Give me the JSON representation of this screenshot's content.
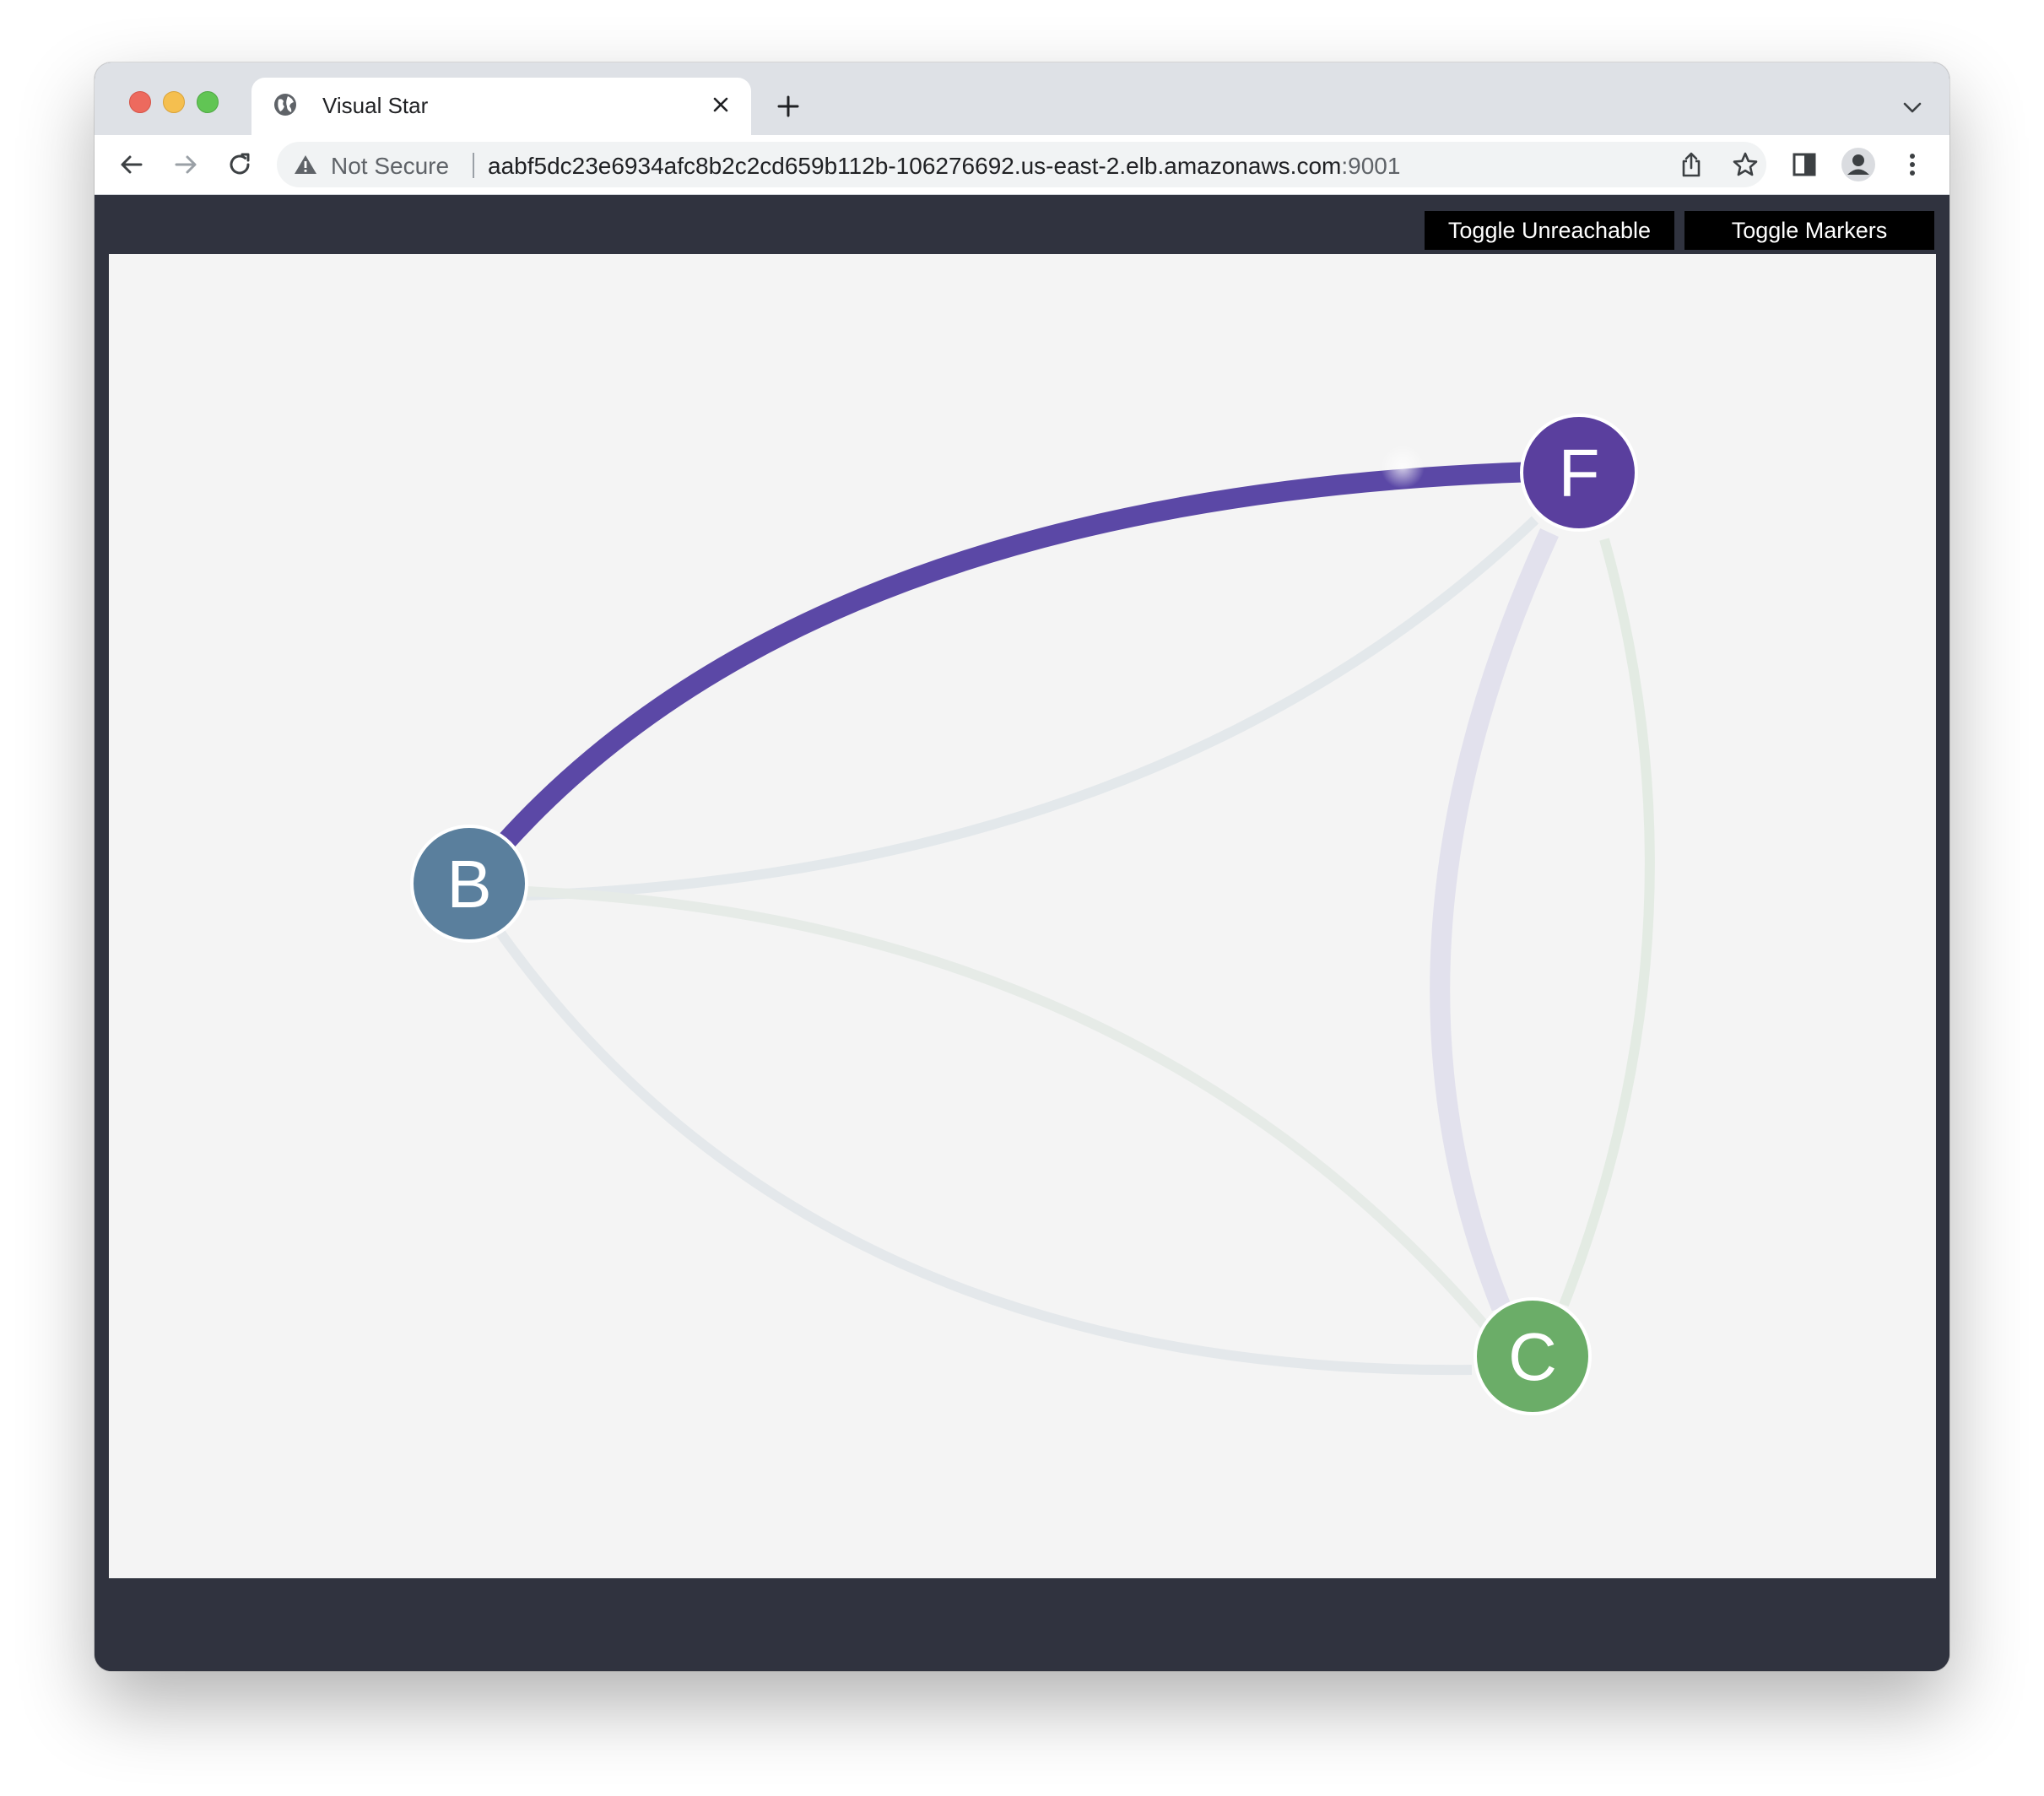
{
  "browser": {
    "tab": {
      "title": "Visual Star",
      "close_glyph": "✕"
    },
    "new_tab_glyph": "+",
    "security_label": "Not Secure",
    "url_host": "aabf5dc23e6934afc8b2c2cd659b112b-106276692.us-east-2.elb.amazonaws.com",
    "url_port": ":9001",
    "icons": [
      "globe-icon",
      "back-arrow-icon",
      "forward-arrow-icon",
      "reload-icon",
      "warning-icon",
      "share-icon",
      "star-icon",
      "side-panel-icon",
      "profile-icon",
      "more-menu-icon",
      "chevron-down-icon"
    ]
  },
  "app": {
    "buttons": {
      "toggle_unreachable": "Toggle Unreachable",
      "toggle_markers": "Toggle Markers"
    },
    "graph": {
      "nodes": [
        {
          "id": "B",
          "label": "B",
          "color": "#5a7f9d"
        },
        {
          "id": "F",
          "label": "F",
          "color": "#5a3f9e"
        },
        {
          "id": "C",
          "label": "C",
          "color": "#6bad68"
        }
      ],
      "edges": [
        {
          "from": "B",
          "to": "F",
          "color": "#5b48a6",
          "state": "active"
        },
        {
          "from": "F",
          "to": "B",
          "color": "#e3e8eb",
          "state": "inactive"
        },
        {
          "from": "B",
          "to": "C",
          "color": "#e6ebe7",
          "state": "inactive"
        },
        {
          "from": "C",
          "to": "B",
          "color": "#e4e8eb",
          "state": "inactive"
        },
        {
          "from": "F",
          "to": "C",
          "color": "#e2e1ed",
          "state": "inactive"
        },
        {
          "from": "C",
          "to": "F",
          "color": "#e3ebe3",
          "state": "inactive"
        }
      ]
    }
  }
}
